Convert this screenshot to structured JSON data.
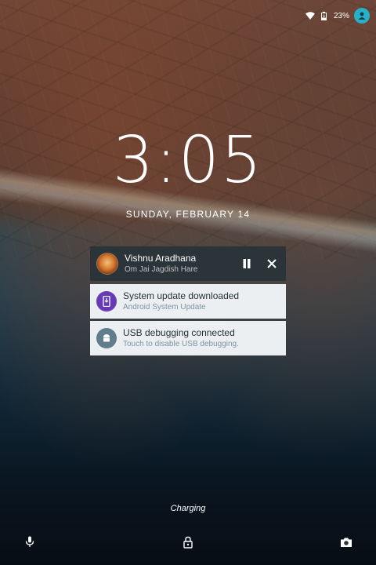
{
  "status_bar": {
    "battery_text": "23%",
    "icons": [
      "wifi-icon",
      "battery-icon",
      "user-avatar-icon"
    ],
    "avatar_color": "#27b1c8"
  },
  "lockscreen": {
    "time": "3:05",
    "date": "SUNDAY, FEBRUARY 14",
    "charging_text": "Charging"
  },
  "notifications": [
    {
      "type": "media",
      "title": "Vishnu Aradhana",
      "subtitle": "Om Jai Jagdish Hare",
      "actions": [
        "pause-icon",
        "close-icon"
      ]
    },
    {
      "type": "system",
      "title": "System update downloaded",
      "subtitle": "Android System Update",
      "icon": "system-update-icon",
      "icon_color": "#673ab7"
    },
    {
      "type": "system",
      "title": "USB debugging connected",
      "subtitle": "Touch to disable USB debugging.",
      "icon": "android-icon",
      "icon_color": "#607d8b"
    }
  ],
  "bottom_bar": {
    "icons": [
      "microphone-icon",
      "lock-icon",
      "camera-icon"
    ]
  }
}
